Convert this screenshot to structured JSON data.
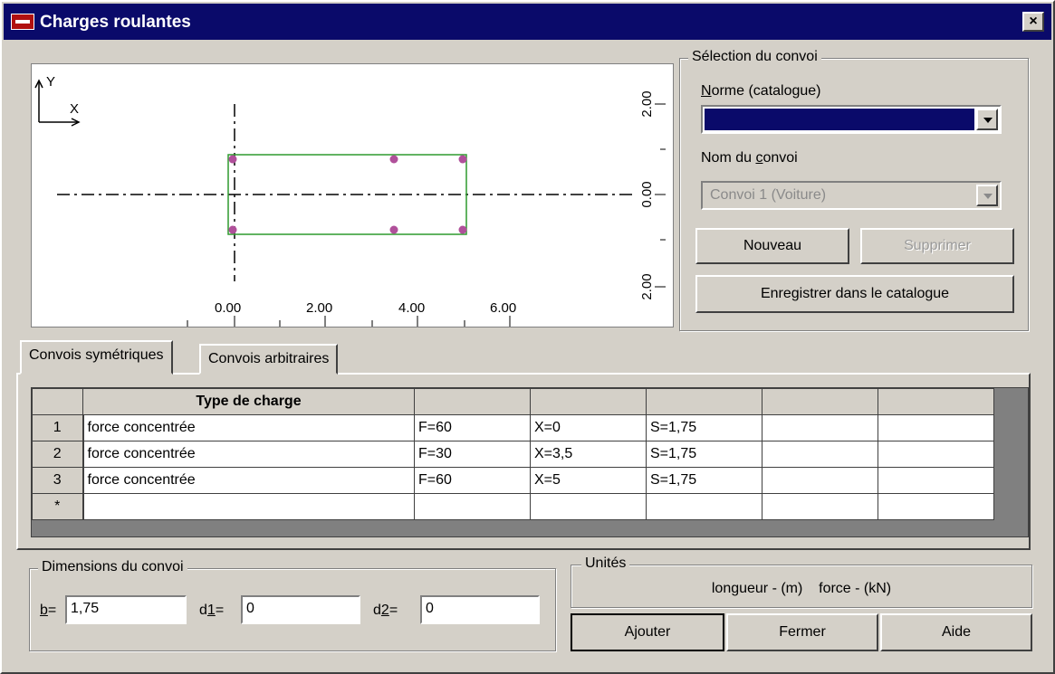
{
  "window": {
    "title": "Charges roulantes",
    "close_label": "×"
  },
  "preview": {
    "axis_y_label": "Y",
    "axis_x_label": "X",
    "x_ticks": [
      "0.00",
      "2.00",
      "4.00",
      "6.00"
    ],
    "y_ticks": [
      "2.00",
      "0.00",
      "2.00"
    ]
  },
  "selection": {
    "group_title": "Sélection du convoi",
    "norme_label_prefix": "",
    "norme_label_u": "N",
    "norme_label_rest": "orme (catalogue)",
    "norme_value": "",
    "nom_label_prefix": "Nom du ",
    "nom_label_u": "c",
    "nom_label_rest": "onvoi",
    "nom_value": "Convoi 1 (Voiture)",
    "nouveau_label": "Nouveau",
    "supprimer_label": "Supprimer",
    "enregistrer_label": "Enregistrer dans le catalogue"
  },
  "tabs": {
    "symetriques": "Convois symétriques",
    "arbitraires": "Convois arbitraires"
  },
  "table": {
    "header": [
      "",
      "Type de charge",
      "",
      "",
      "",
      "",
      ""
    ],
    "rows": [
      {
        "num": "1",
        "type": "force concentrée",
        "f": "F=60",
        "x": "X=0",
        "s": "S=1,75"
      },
      {
        "num": "2",
        "type": "force concentrée",
        "f": "F=30",
        "x": "X=3,5",
        "s": "S=1,75"
      },
      {
        "num": "3",
        "type": "force concentrée",
        "f": "F=60",
        "x": "X=5",
        "s": "S=1,75"
      },
      {
        "num": "*",
        "type": "",
        "f": "",
        "x": "",
        "s": ""
      }
    ]
  },
  "dimensions": {
    "group_title": "Dimensions du convoi",
    "b_label_u": "b",
    "b_label_rest": "=",
    "b_value": "1,75",
    "d1_label_pre": "d",
    "d1_label_u": "1",
    "d1_label_rest": "=",
    "d1_value": "0",
    "d2_label_pre": "d",
    "d2_label_u": "2",
    "d2_label_rest": "=",
    "d2_value": "0"
  },
  "units": {
    "group_title": "Unités",
    "text": "longueur - (m)    force - (kN)"
  },
  "buttons": {
    "ajouter": "Ajouter",
    "fermer": "Fermer",
    "aide": "Aide"
  },
  "colors": {
    "title_bar": "#0a0a6a",
    "rect_outline": "#2e9a2e",
    "load_point": "#b0509a"
  }
}
